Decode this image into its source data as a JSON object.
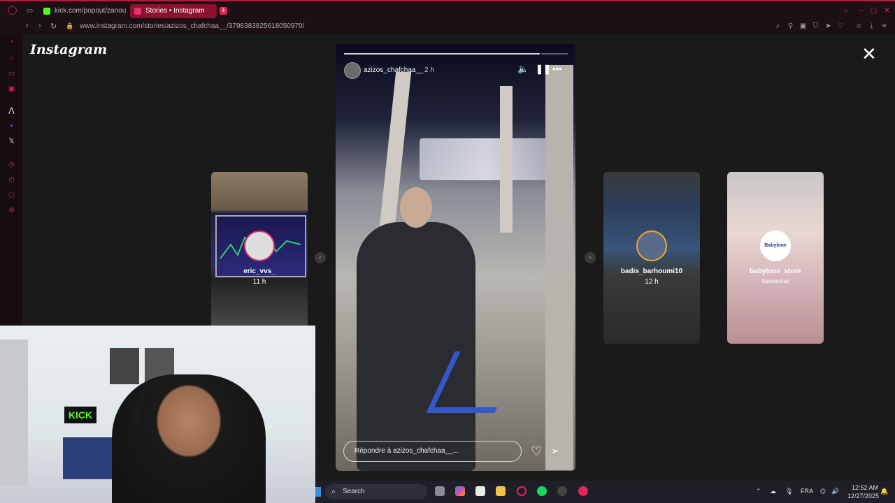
{
  "browser": {
    "tabs": [
      {
        "label": "kick.com/popout/zanoune",
        "color": "#53fc18"
      },
      {
        "label": "Stories • Instagram",
        "color": "#e1306c"
      }
    ],
    "url": "www.instagram.com/stories/azizos_chafchaa__/3796383825618050970/"
  },
  "instagram": {
    "logo": "Instagram",
    "close_icon": "✕",
    "story": {
      "username": "azizos_chafchaa__",
      "time": "2 h",
      "reply_placeholder": "Répondre à azizos_chafchaa__...",
      "progress_fraction": 0.875
    },
    "side_stories": [
      {
        "name": "eric_vvs_",
        "time": "11 h"
      },
      {
        "name": "badis_barhoumi10",
        "time": "12 h"
      },
      {
        "name": "babylone_store",
        "time": "Sponsorisé",
        "logo": "Babylone"
      }
    ]
  },
  "webcam": {
    "sign": "KICK"
  },
  "taskbar": {
    "search_label": "Search",
    "language": "FRA",
    "time": "12:52 AM",
    "date": "12/27/2025"
  }
}
